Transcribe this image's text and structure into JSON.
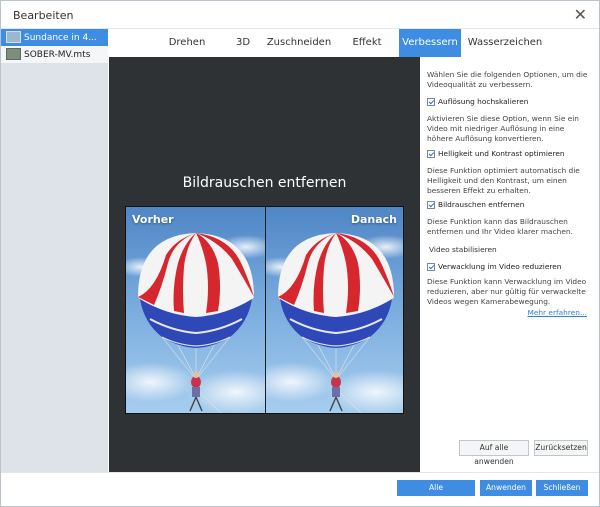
{
  "window": {
    "title": "Bearbeiten"
  },
  "files": [
    {
      "name": "Sundance in 4...",
      "selected": true
    },
    {
      "name": "SOBER-MV.mts",
      "selected": false
    }
  ],
  "tabs": [
    {
      "label": "Drehen",
      "active": false
    },
    {
      "label": "3D",
      "active": false
    },
    {
      "label": "Zuschneiden",
      "active": false
    },
    {
      "label": "Effekt",
      "active": false
    },
    {
      "label": "Verbessern",
      "active": true
    },
    {
      "label": "Wasserzeichen",
      "active": false
    }
  ],
  "preview": {
    "title": "Bildrauschen entfernen",
    "before_label": "Vorher",
    "after_label": "Danach"
  },
  "settings": {
    "intro": "Wählen Sie die folgenden Optionen, um die Videoqualität zu verbessern.",
    "upscale": {
      "label": "Auflösung hochskalieren",
      "checked": true,
      "desc": "Aktivieren Sie diese Option, wenn Sie ein Video mit niedriger Auflösung in eine höhere Auflösung konvertieren."
    },
    "brightness": {
      "label": "Helligkeit und Kontrast optimieren",
      "checked": true,
      "desc": "Diese Funktion optimiert automatisch die Helligkeit und den Kontrast, um einen besseren Effekt zu erhalten."
    },
    "denoise": {
      "label": "Bildrauschen entfernen",
      "checked": true,
      "desc": "Diese Funktion kann das Bildrauschen entfernen und Ihr Video klarer machen."
    },
    "stabilize_heading": "Video stabilisieren",
    "shake": {
      "label": "Verwacklung im Video reduzieren",
      "checked": true,
      "desc": "Diese Funktion kann Verwacklung im Video reduzieren, aber nur gültig für verwackelte Videos wegen Kamerabewegung."
    },
    "more_link": "Mehr erfahren..."
  },
  "actions": {
    "apply_all": "Auf alle anwenden",
    "reset": "Zurücksetzen",
    "restore_all": "Alle wiederherstellen",
    "apply": "Anwenden",
    "close": "Schließen"
  },
  "colors": {
    "accent": "#3e8de3",
    "preview_bg": "#2f3234",
    "sidebar_bg": "#dde3e8"
  }
}
